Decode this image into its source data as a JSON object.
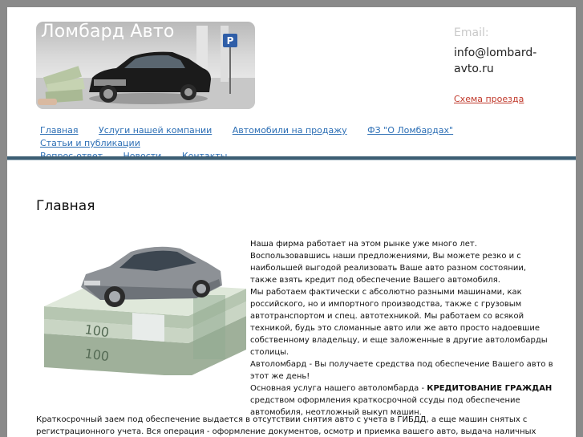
{
  "header": {
    "site_title": "Ломбард Авто",
    "parking_sign": "P",
    "email_label": "Email:",
    "email_value": "info@lombard-avto.ru",
    "map_link": "Схема проезда"
  },
  "nav": {
    "items": [
      "Главная",
      "Услуги нашей компании",
      "Автомобили на продажу",
      "ФЗ \"О Ломбардах\"",
      "Статьи и публикации",
      "Вопрос-ответ",
      "Новости",
      "Контакты"
    ]
  },
  "main": {
    "heading": "Главная",
    "intro_lines": [
      "Наша фирма работает на этом рынке уже много лет.",
      "Воспользовавшись наши предложениями, Вы можете резко и с наибольшей выгодой реализовать Ваше авто разном состоянии, также взять кредит под обеспечение Вашего автомобиля.",
      "Мы работаем фактически с абсолютно разными машинами, как российского, но и импортного производства, также с грузовым автотранспортом и спец. автотехникой. Мы работаем со всякой техникой, будь это сломанные авто или же авто просто надоевшие собственному владельцу, и еще заложенные в другие автоломбарды столицы.",
      "Автоломбард - Вы получаете средства под обеспечение Вашего авто в этот же день!"
    ],
    "service_prefix": "Основная услуга нашего автоломбарда - ",
    "service_bold": "КРЕДИТОВАНИЕ ГРАЖДАН",
    "service_suffix": " средством оформления краткосрочной ссуды под обеспечение автомобиля, неотложный выкуп машин.",
    "bottom_text": "Краткосрочный заем под обеспечение выдается в отсутствии снятия авто с учета в ГИБДД, а еще машин снятых с регистрационного учета. Вся операция - оформление документов, осмотр и приемка вашего авто, выдача наличных средств - случается в нужном месте"
  },
  "colors": {
    "link": "#2d6fb5",
    "map_link": "#c0392b",
    "rule": "#3d5e73"
  }
}
